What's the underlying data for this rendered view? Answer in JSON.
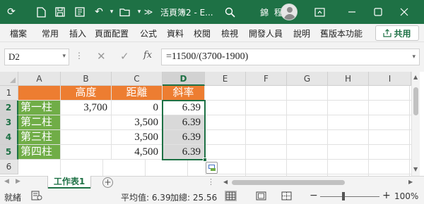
{
  "titlebar": {
    "title": "活頁簿2 - E...",
    "user": "錦 程",
    "autosave_icon": "sync-icon",
    "window_controls": [
      "minimize",
      "maximize",
      "close"
    ]
  },
  "menu": {
    "items": [
      "檔案",
      "常用",
      "插入",
      "頁面配置",
      "公式",
      "資料",
      "校閱",
      "檢視",
      "開發人員",
      "說明",
      "舊版本功能"
    ],
    "share_label": "共用"
  },
  "formula_bar": {
    "name_box": "D2",
    "formula": "=11500/(3700-1900)",
    "fx_label": "fx"
  },
  "sheet": {
    "columns": [
      "A",
      "B",
      "C",
      "D",
      "E",
      "F",
      "G",
      "H",
      "I"
    ],
    "rows": [
      "1",
      "2",
      "3",
      "4",
      "5",
      "6"
    ],
    "active_cell": "D2",
    "cells": {
      "B1": "高度",
      "C1": "距離",
      "D1": "斜率",
      "A2": "第一柱",
      "B2": "3,700",
      "C2": "0",
      "D2": "6.39",
      "A3": "第二柱",
      "C3": "3,500",
      "D3": "6.39",
      "A4": "第三柱",
      "C4": "3,500",
      "D4": "6.39",
      "A5": "第四柱",
      "C5": "4,500",
      "D5": "6.39"
    },
    "header_fill_color": "#ed7d31",
    "label_fill_color": "#70ad47",
    "selection_color": "#1e7145"
  },
  "tabs": {
    "sheets": [
      "工作表1"
    ],
    "active": "工作表1"
  },
  "status": {
    "ready": "就緒",
    "average": "平均值: 6.39",
    "sum": "加總: 25.56",
    "zoom": "100%"
  }
}
